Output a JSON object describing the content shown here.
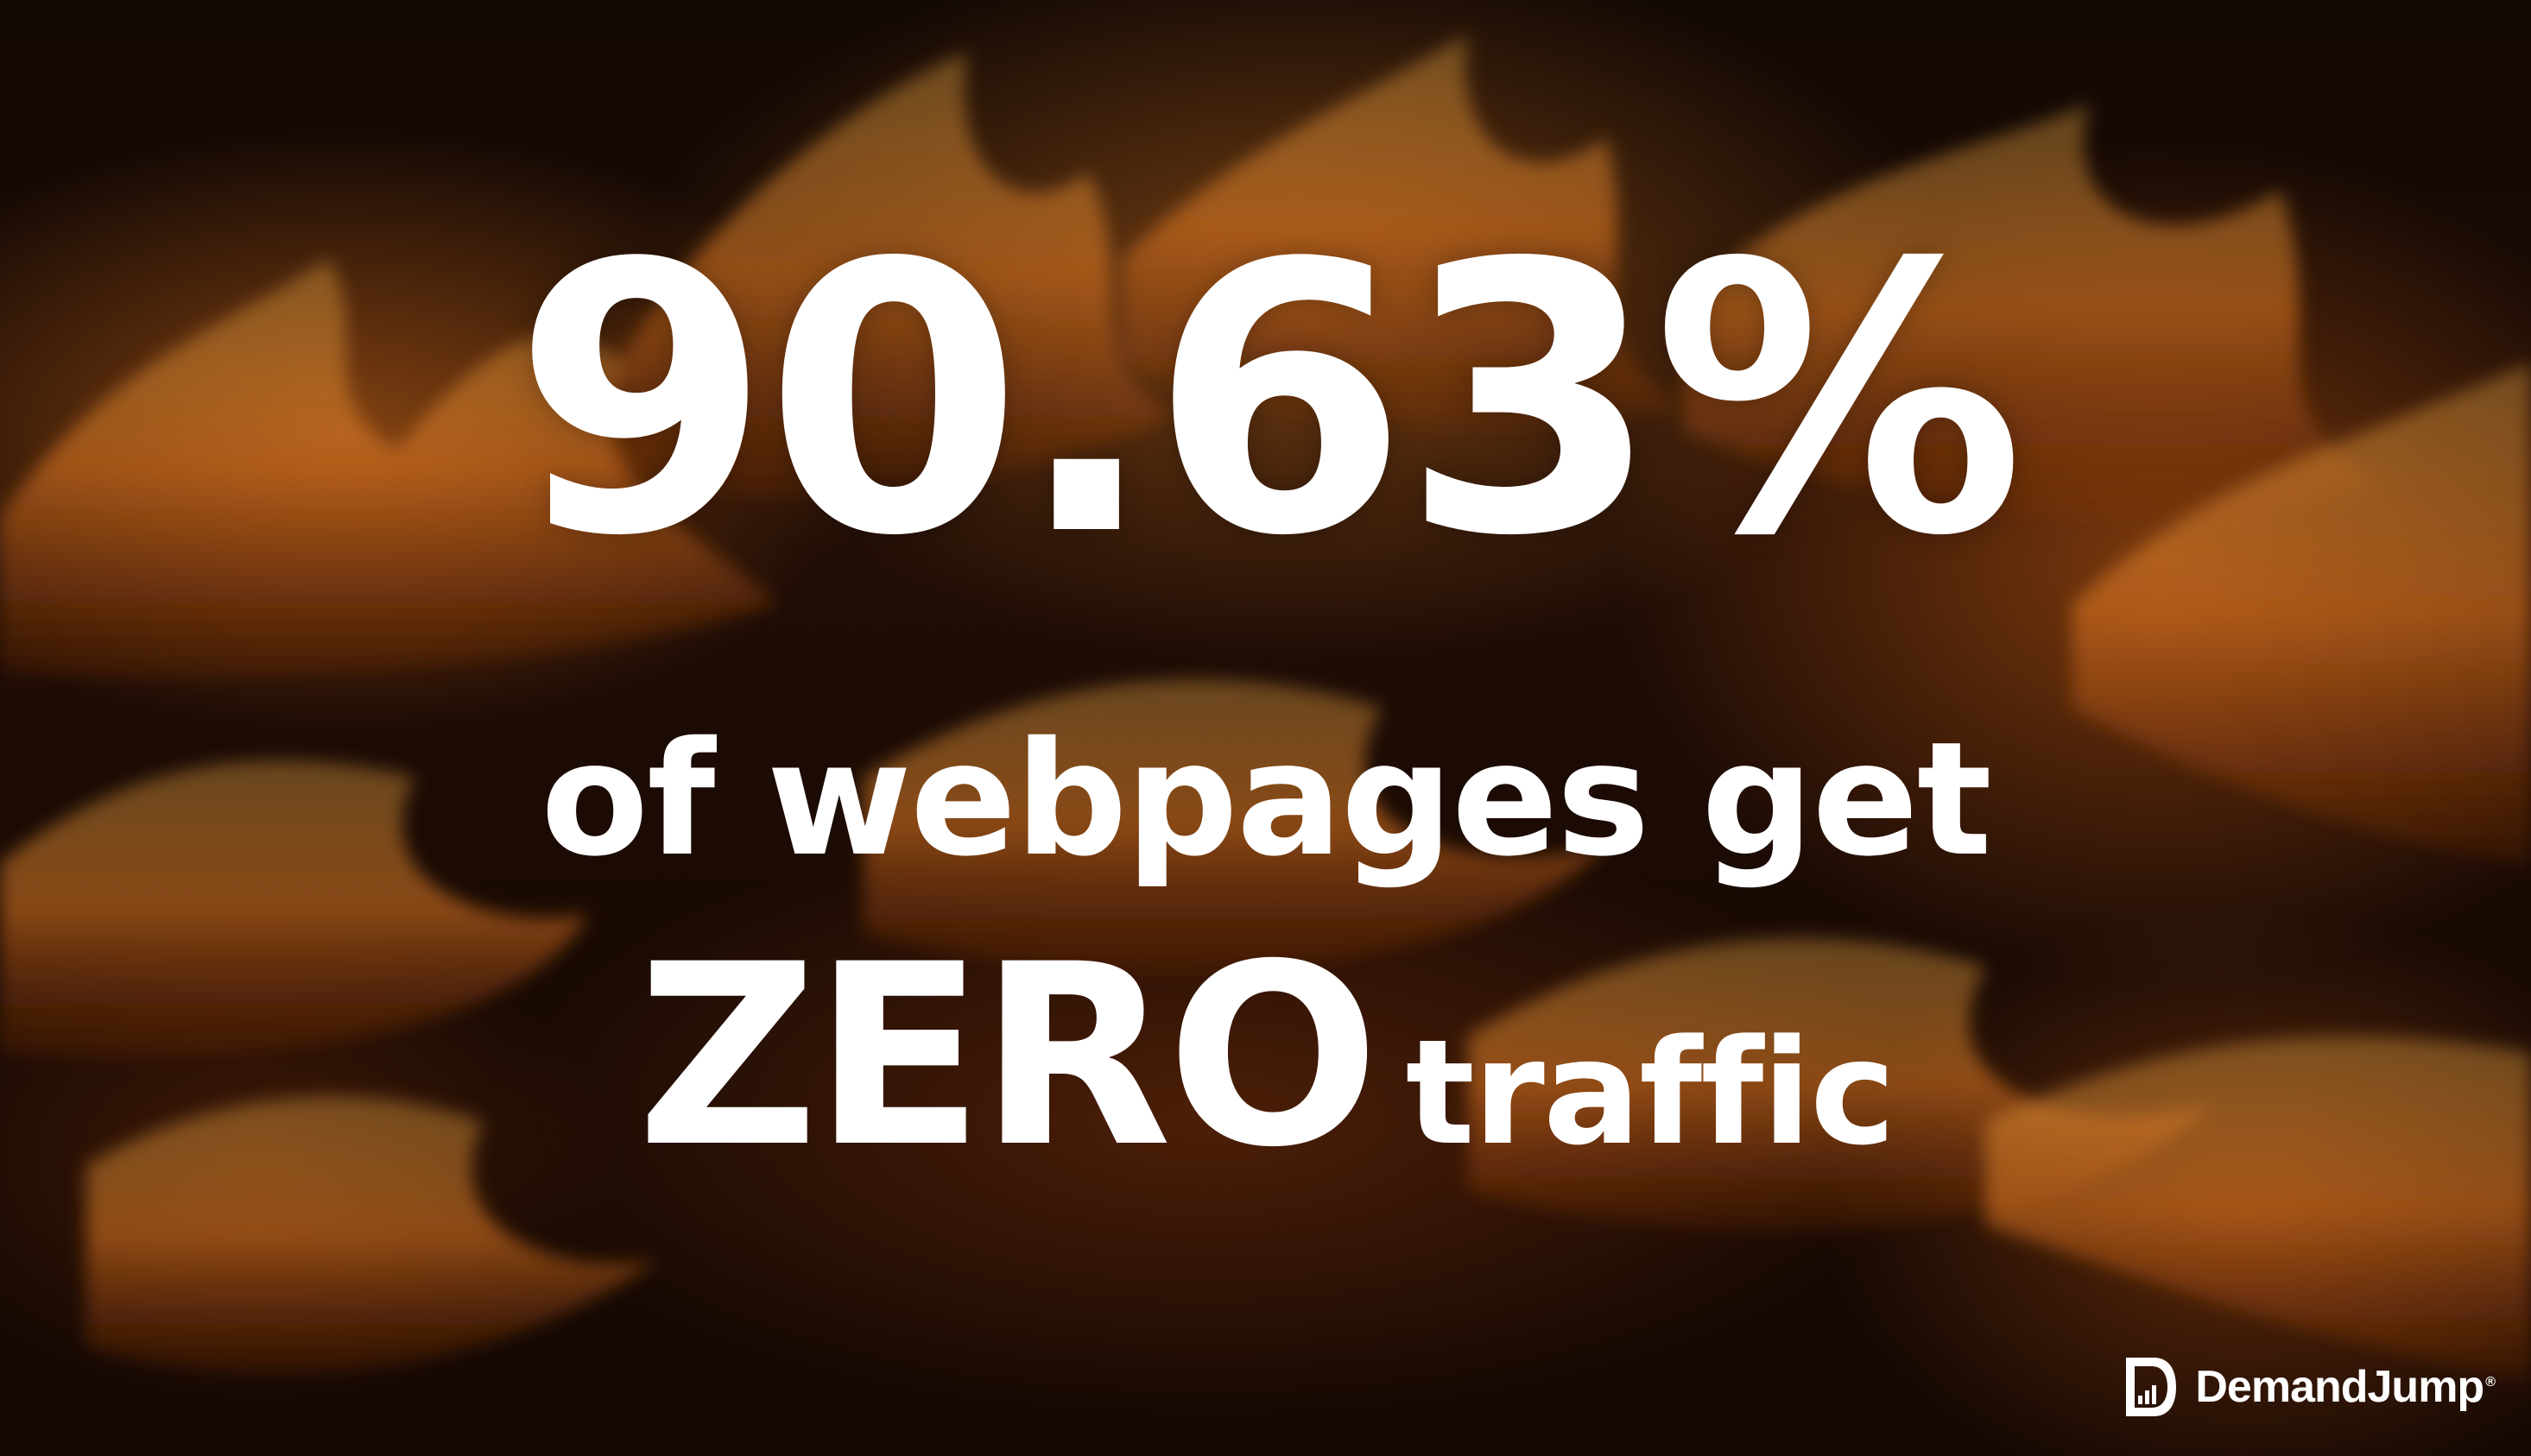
{
  "headline": {
    "stat": "90.63%",
    "line_two": "of webpages get",
    "emphasis": "ZERO",
    "trailing": "traffic"
  },
  "branding": {
    "name": "DemandJump",
    "registered_mark": "®"
  },
  "colors": {
    "text": "#ffffff",
    "flame_orange": "#e07a22",
    "background_dark": "#0a0503"
  },
  "icons": {
    "brand_logo": "demandjump-logo-icon"
  }
}
